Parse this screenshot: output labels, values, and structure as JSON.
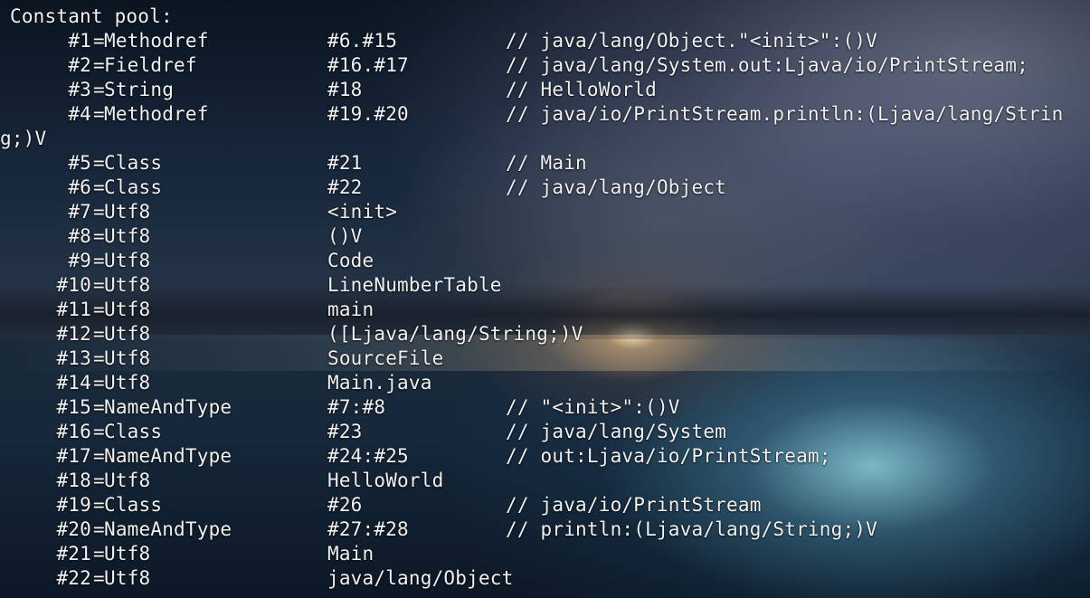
{
  "header": "Constant pool:",
  "wrap_tail": "g;)V",
  "entries": [
    {
      "idx": "#1",
      "type": "Methodref",
      "ref": "#6.#15",
      "comment": "// java/lang/Object.\"<init>\":()V"
    },
    {
      "idx": "#2",
      "type": "Fieldref",
      "ref": "#16.#17",
      "comment": "// java/lang/System.out:Ljava/io/PrintStream;"
    },
    {
      "idx": "#3",
      "type": "String",
      "ref": "#18",
      "comment": "// HelloWorld"
    },
    {
      "idx": "#4",
      "type": "Methodref",
      "ref": "#19.#20",
      "comment": "// java/io/PrintStream.println:(Ljava/lang/Strin"
    },
    {
      "idx": "#5",
      "type": "Class",
      "ref": "#21",
      "comment": "// Main"
    },
    {
      "idx": "#6",
      "type": "Class",
      "ref": "#22",
      "comment": "// java/lang/Object"
    },
    {
      "idx": "#7",
      "type": "Utf8",
      "ref": "<init>",
      "comment": ""
    },
    {
      "idx": "#8",
      "type": "Utf8",
      "ref": "()V",
      "comment": ""
    },
    {
      "idx": "#9",
      "type": "Utf8",
      "ref": "Code",
      "comment": ""
    },
    {
      "idx": "#10",
      "type": "Utf8",
      "ref": "LineNumberTable",
      "comment": ""
    },
    {
      "idx": "#11",
      "type": "Utf8",
      "ref": "main",
      "comment": ""
    },
    {
      "idx": "#12",
      "type": "Utf8",
      "ref": "([Ljava/lang/String;)V",
      "comment": ""
    },
    {
      "idx": "#13",
      "type": "Utf8",
      "ref": "SourceFile",
      "comment": ""
    },
    {
      "idx": "#14",
      "type": "Utf8",
      "ref": "Main.java",
      "comment": ""
    },
    {
      "idx": "#15",
      "type": "NameAndType",
      "ref": "#7:#8",
      "comment": "// \"<init>\":()V"
    },
    {
      "idx": "#16",
      "type": "Class",
      "ref": "#23",
      "comment": "// java/lang/System"
    },
    {
      "idx": "#17",
      "type": "NameAndType",
      "ref": "#24:#25",
      "comment": "// out:Ljava/io/PrintStream;"
    },
    {
      "idx": "#18",
      "type": "Utf8",
      "ref": "HelloWorld",
      "comment": ""
    },
    {
      "idx": "#19",
      "type": "Class",
      "ref": "#26",
      "comment": "// java/io/PrintStream"
    },
    {
      "idx": "#20",
      "type": "NameAndType",
      "ref": "#27:#28",
      "comment": "// println:(Ljava/lang/String;)V"
    },
    {
      "idx": "#21",
      "type": "Utf8",
      "ref": "Main",
      "comment": ""
    },
    {
      "idx": "#22",
      "type": "Utf8",
      "ref": "java/lang/Object",
      "comment": ""
    }
  ]
}
